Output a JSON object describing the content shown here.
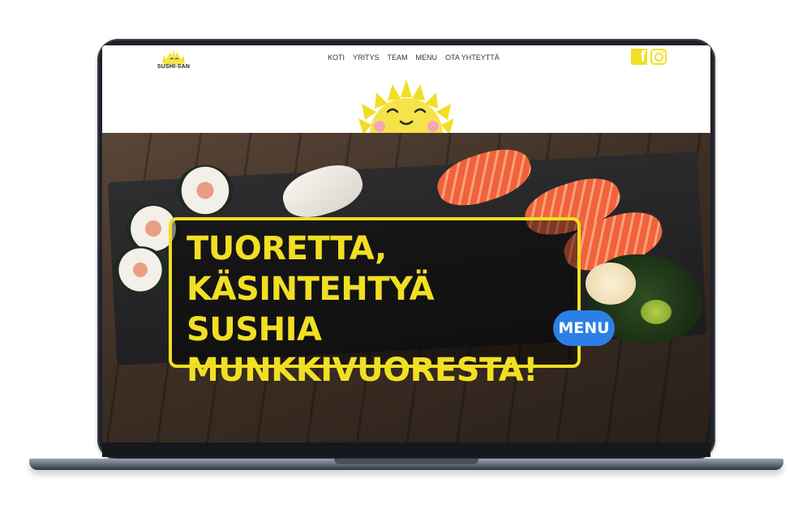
{
  "brand": {
    "logo_text": "SUSHI-SAN"
  },
  "nav": {
    "items": [
      "KOTI",
      "YRITYS",
      "TEAM",
      "MENU",
      "OTA YHTEYTTÄ"
    ]
  },
  "social": {
    "facebook_glyph": "f",
    "icons": [
      "facebook-icon",
      "instagram-icon"
    ]
  },
  "hero": {
    "headline": [
      "TUORETTA,",
      "KÄSINTEHTYÄ SUSHIA",
      "MUNKKIVUORESTA!"
    ],
    "cta_label": "MENU"
  },
  "colors": {
    "accent_yellow": "#f1df23",
    "cta_blue": "#2c7fe6",
    "cheek_pink": "#f4a6b5"
  }
}
